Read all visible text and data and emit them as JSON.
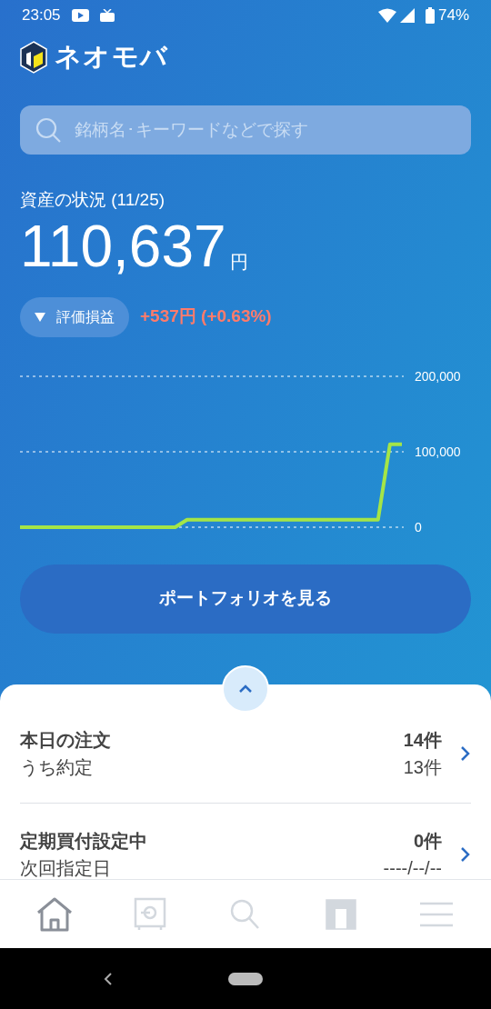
{
  "status_bar": {
    "time": "23:05",
    "battery": "74%"
  },
  "app": {
    "name": "ネオモバ"
  },
  "search": {
    "placeholder": "銘柄名･キーワードなどで探す"
  },
  "assets": {
    "label": "資産の状況 (11/25)",
    "value": "110,637",
    "unit": "円",
    "toggle": {
      "label": "評価損益",
      "expanded": true
    },
    "change": "+537円 (+0.63%)"
  },
  "chart_data": {
    "type": "line",
    "yticks": [
      {
        "value": 0,
        "label": "0"
      },
      {
        "value": 100000,
        "label": "100,000"
      },
      {
        "value": 200000,
        "label": "200,000"
      }
    ],
    "ylim": [
      0,
      200000
    ],
    "series": [
      {
        "color": "#a4e547",
        "values": [
          0,
          0,
          0,
          0,
          0,
          0,
          0,
          0,
          0,
          0,
          0,
          0,
          0,
          0,
          10000,
          10000,
          10000,
          10000,
          10000,
          10000,
          10000,
          10000,
          10000,
          10000,
          10000,
          10000,
          10000,
          10000,
          10000,
          10000,
          10000,
          110000,
          110000
        ]
      }
    ]
  },
  "portfolio_button": {
    "label": "ポートフォリオを見る"
  },
  "summary": {
    "rows": [
      {
        "title": "本日の注文",
        "value": "14件",
        "sub_label": "うち約定",
        "sub_value": "13件"
      },
      {
        "title": "定期買付設定中",
        "value": "0件",
        "sub_label": "次回指定日",
        "sub_value": "----/--/--"
      }
    ]
  },
  "nav": [
    {
      "kind": "home",
      "selected": true
    },
    {
      "kind": "safe",
      "selected": false
    },
    {
      "kind": "search",
      "selected": false
    },
    {
      "kind": "t",
      "selected": false
    },
    {
      "kind": "menu",
      "selected": false
    }
  ]
}
